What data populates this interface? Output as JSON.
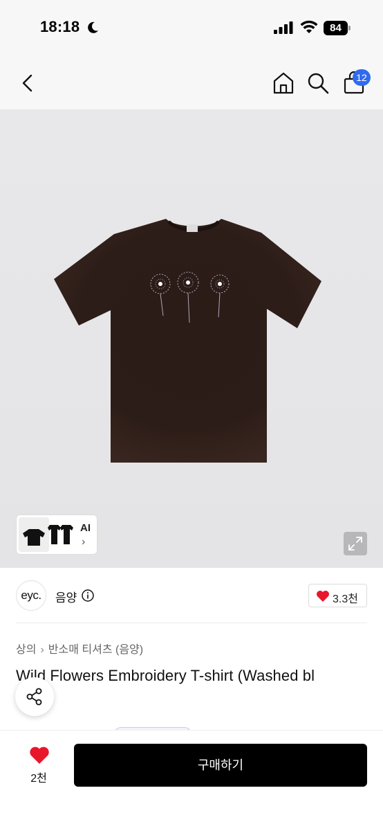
{
  "status_bar": {
    "time": "18:18",
    "battery": "84",
    "icons": [
      "moon-icon",
      "signal-icon",
      "wifi-icon",
      "battery-icon"
    ]
  },
  "header": {
    "icons": [
      "back-icon",
      "home-icon",
      "search-icon",
      "cart-icon"
    ],
    "cart_badge": "12"
  },
  "gallery": {
    "ai_label": "AI",
    "ai_chevron": "›",
    "icons": [
      "expand-icon"
    ]
  },
  "brand": {
    "logo_text": "eyc.",
    "name": "음양",
    "like_count": "3.3천"
  },
  "breadcrumb": {
    "category": "상의",
    "separator": "›",
    "subcategory": "반소매 티셔츠 (음양)"
  },
  "product": {
    "title": "Wild Flowers Embroidery T-shirt (Washed bl"
  },
  "bottom_bar": {
    "wish_count": "2천",
    "buy_label": "구매하기"
  },
  "colors": {
    "accent": "#2f6bf0",
    "heart": "#e8172c",
    "buy_button": "#000000",
    "shirt": "#2a1b17"
  }
}
